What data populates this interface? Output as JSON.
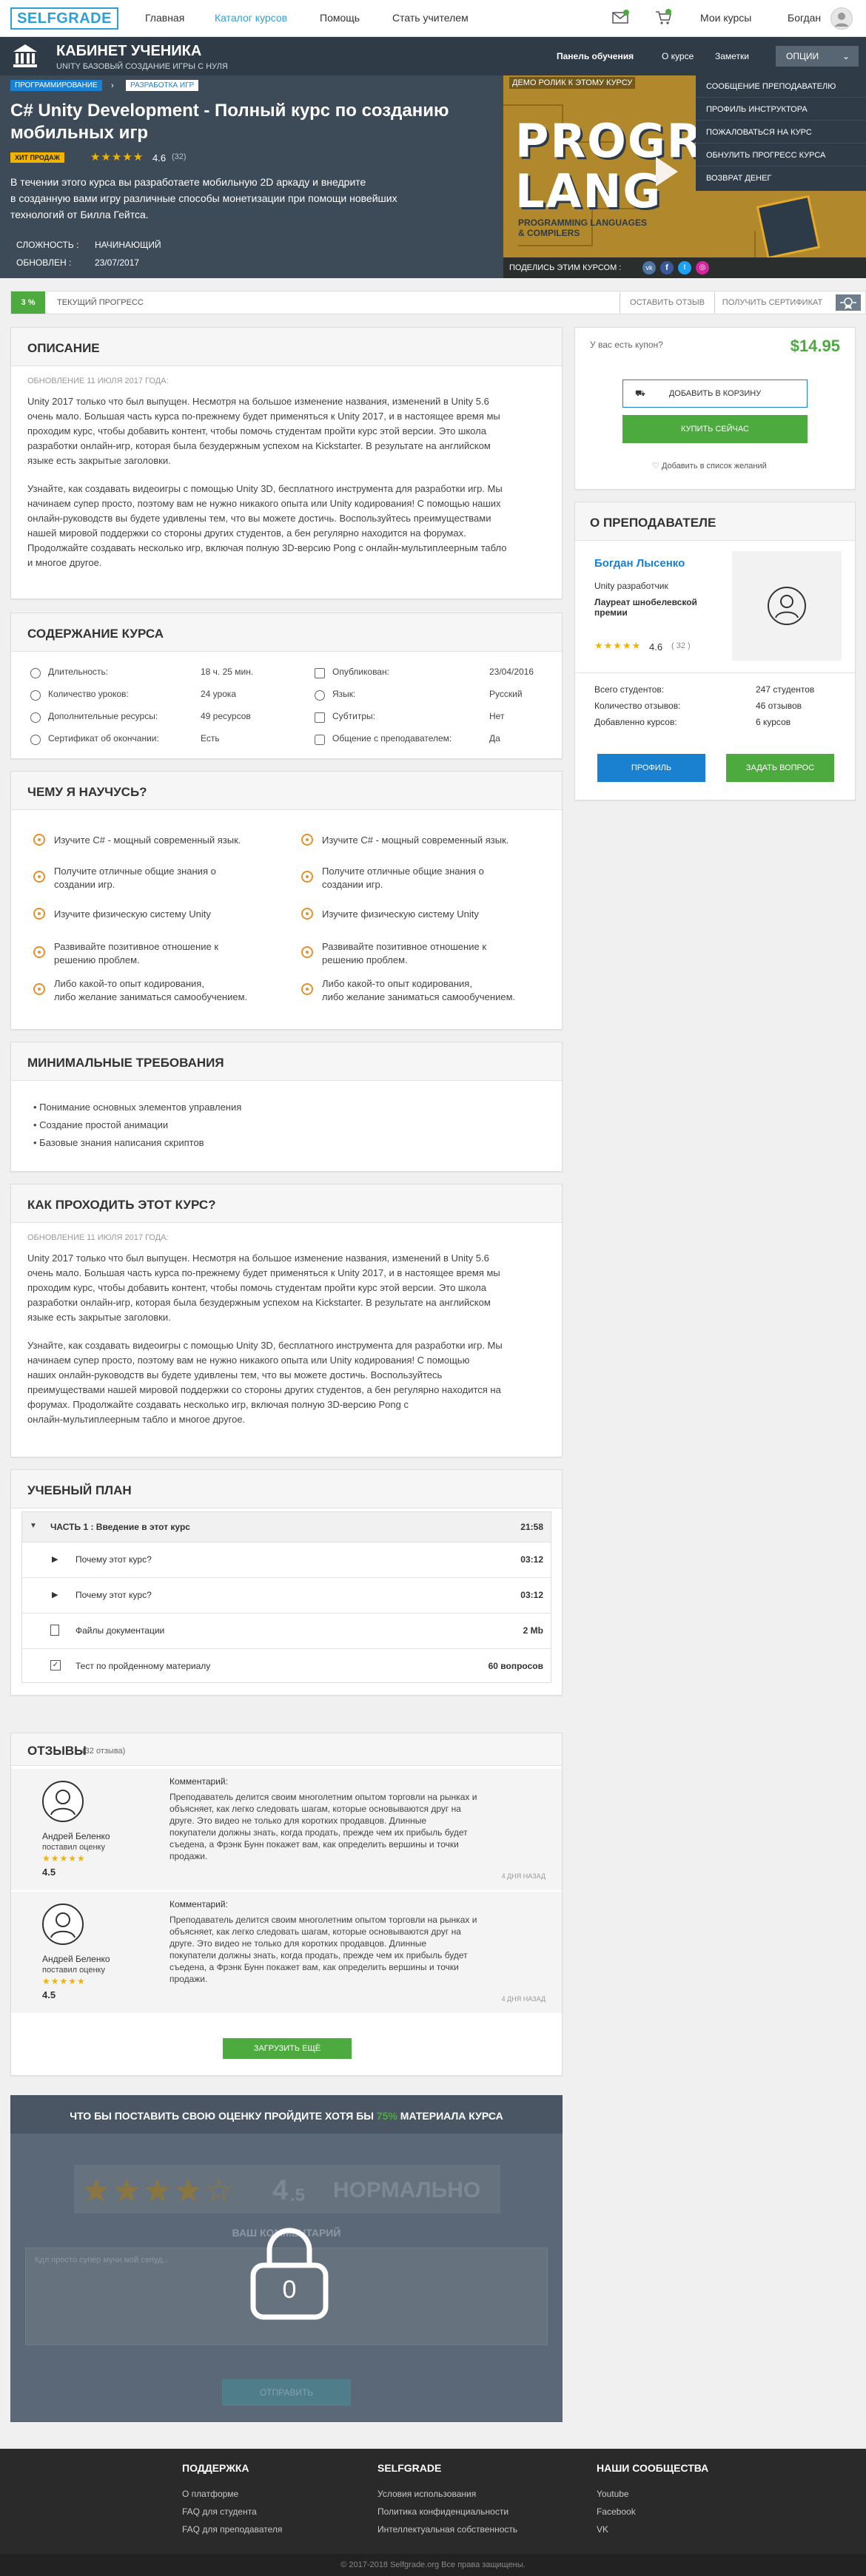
{
  "nav": {
    "logo": "SELFGRADE",
    "links": [
      "Главная",
      "Каталог курсов",
      "Помощь",
      "Стать учителем"
    ],
    "my_courses": "Мои курсы",
    "user": "Богдан",
    "icons": [
      "mail-icon",
      "cart-icon",
      "avatar-icon"
    ]
  },
  "header": {
    "title": "КАБИНЕТ УЧЕНИКА",
    "subtitle": "UNITY БАЗОВЫЙ СОЗДАНИЕ ИГРЫ С НУЛЯ",
    "tabs": [
      "Панель обучения",
      "О курсе",
      "Заметки"
    ],
    "options": "ОПЦИИ"
  },
  "course": {
    "breadcrumb": [
      "ПРОГРАММИРОВАНИЕ",
      "РАЗРАБОТКА ИГР"
    ],
    "title_line1": "C# Unity Development - Полный курс по созданию",
    "title_line2": "мобильных игр",
    "badge": "ХИТ ПРОДАЖ",
    "rating": "4.6",
    "rating_count": "(32)",
    "description_line1": "В течении этого курса вы разработаете мобильную 2D аркаду и внедрите",
    "description_line2": "в созданную вами игру различные способы монетизации при помощи новейших",
    "description_line3": "технологий от Билла Гейтса.",
    "complexity_label": "СЛОЖНОСТЬ :",
    "complexity_value": "НАЧИНАЮЩИЙ",
    "updated_label": "ОБНОВЛЕН :",
    "updated_value": "23/07/2017"
  },
  "video": {
    "demo_label": "ДЕМО РОЛИК К ЭТОМУ КУРСУ",
    "big_text_1": "PROGRA",
    "big_text_2": "LANG",
    "sub_text": "PROGRAMMING LANGUAGES",
    "sub_text2": "& COMPILERS",
    "share_label": "ПОДЕЛИСЬ ЭТИМ КУРСОМ :",
    "menu": [
      "СООБЩЕНИЕ ПРЕПОДАВАТЕЛЮ",
      "ПРОФИЛЬ ИНСТРУКТОРА",
      "ПОЖАЛОВАТЬСЯ НА КУРС",
      "ОБНУЛИТЬ ПРОГРЕСС КУРСА",
      "ВОЗВРАТ ДЕНЕГ"
    ]
  },
  "progress": {
    "percent": "3 %",
    "value": 0.03,
    "label": "ТЕКУЩИЙ ПРОГРЕСС",
    "btn_review": "ОСТАВИТЬ ОТЗЫВ",
    "btn_certificate": "ПОЛУЧИТЬ СЕРТИФИКАТ"
  },
  "description": {
    "title": "ОПИСАНИЕ",
    "updated": "ОБНОВЛЕНИЕ 11 ИЮЛЯ 2017 ГОДА:",
    "p1": [
      "Unity 2017 только что был выпущен. Несмотря на большое изменение названия, изменений в Unity 5.6",
      "очень мало. Большая часть курса по-прежнему будет применяться к Unity 2017, и в настоящее время мы",
      "проходим курс, чтобы добавить контент, чтобы помочь студентам пройти курс этой версии. Это школа",
      "разработки онлайн-игр, которая была безудержным успехом на Kickstarter. В результате на английском",
      "языке есть закрытые заголовки."
    ],
    "p2": [
      "Узнайте, как создавать видеоигры с помощью Unity 3D, бесплатного инструмента для разработки игр. Мы",
      "начинаем супер просто, поэтому вам не нужно никакого опыта или Unity кодирования! С помощью наших",
      "онлайн-руководств вы будете удивлены тем, что вы можете достичь. Воспользуйтесь преимуществами",
      "нашей мировой поддержки со стороны других студентов, а бен регулярно находится на форумах.",
      "Продолжайте создавать несколько игр, включая полную 3D-версию Pong с онлайн-мультиплеерным табло",
      "и многое другое."
    ]
  },
  "content": {
    "title": "СОДЕРЖАНИЕ КУРСА",
    "left": [
      {
        "icon": "clock-icon",
        "label": "Длительность:",
        "value": "18 ч. 25 мин."
      },
      {
        "icon": "play-icon",
        "label": "Количество уроков:",
        "value": "24 урока"
      },
      {
        "icon": "download-icon",
        "label": "Дополнительные ресурсы:",
        "value": "49 ресурсов"
      },
      {
        "icon": "certificate-icon",
        "label": "Сертификат об окончании:",
        "value": "Есть"
      }
    ],
    "right": [
      {
        "icon": "calendar-icon",
        "label": "Опубликован:",
        "value": "23/04/2016"
      },
      {
        "icon": "globe-icon",
        "label": "Язык:",
        "value": "Русский"
      },
      {
        "icon": "subtitles-icon",
        "label": "Субтитры:",
        "value": "Нет"
      },
      {
        "icon": "chat-icon",
        "label": "Общение с преподавателем:",
        "value": "Да"
      }
    ]
  },
  "learn": {
    "title": "ЧЕМУ Я НАУЧУСЬ?",
    "left": [
      [
        "Изучите C# - мощный современный язык."
      ],
      [
        "Получите отличные общие знания о",
        "создании игр."
      ],
      [
        "Изучите физическую систему Unity"
      ],
      [
        "Развивайте позитивное отношение к",
        "решению проблем."
      ],
      [
        "Либо какой-то опыт кодирования,",
        "либо желание заниматься самообучением."
      ]
    ],
    "right": [
      [
        "Изучите C# - мощный современный язык."
      ],
      [
        "Получите отличные общие знания о",
        "создании игр."
      ],
      [
        "Изучите физическую систему Unity"
      ],
      [
        "Развивайте позитивное отношение к",
        "решению проблем."
      ],
      [
        "Либо какой-то опыт кодирования,",
        "либо желание заниматься самообучением."
      ]
    ]
  },
  "requirements": {
    "title": "МИНИМАЛЬНЫЕ ТРЕБОВАНИЯ",
    "items": [
      "Понимание основных элементов управления",
      "Создание простой анимации",
      "Базовые знания написания скриптов"
    ]
  },
  "howto": {
    "title": "КАК ПРОХОДИТЬ ЭТОТ КУРС?",
    "updated": "ОБНОВЛЕНИЕ 11 ИЮЛЯ 2017 ГОДА:",
    "p1": [
      "Unity 2017 только что был выпущен. Несмотря на большое изменение названия, изменений в Unity 5.6",
      "очень мало. Большая часть курса по-прежнему будет применяться к Unity 2017, и в настоящее время мы",
      "проходим курс, чтобы добавить контент, чтобы помочь студентам пройти курс этой версии. Это школа",
      "разработки онлайн-игр, которая была безудержным успехом на Kickstarter. В результате на английском",
      "языке есть закрытые заголовки."
    ],
    "p2": [
      "Узнайте, как создавать видеоигры с помощью Unity 3D, бесплатного инструмента для разработки игр. Мы",
      "начинаем супер просто, поэтому вам не нужно никакого опыта или Unity кодирования! С помощью",
      "наших онлайн-руководств вы будете удивлены тем, что вы можете достичь. Воспользуйтесь",
      "преимуществами нашей мировой поддержки со стороны других студентов, а бен регулярно находится на",
      "форумах. Продолжайте создавать несколько игр, включая полную 3D-версию Pong с",
      "онлайн-мультиплеерным табло и многое другое."
    ]
  },
  "plan": {
    "title": "УЧЕБНЫЙ ПЛАН",
    "section": "ЧАСТЬ 1 : Введение в этот курс",
    "section_time": "21:58",
    "rows": [
      {
        "icon": "play-icon",
        "label": "Почему этот курс?",
        "value": "03:12"
      },
      {
        "icon": "play-icon",
        "label": "Почему этот курс?",
        "value": "03:12"
      },
      {
        "icon": "document-icon",
        "label": "Файлы документации",
        "value": "2 Mb"
      },
      {
        "icon": "test-icon",
        "label": "Тест по пройденному материалу",
        "value": "60 вопросов"
      }
    ]
  },
  "reviews": {
    "title": "ОТЗЫВЫ",
    "count": "(32 отзыва)",
    "items": [
      {
        "name": "Андрей Беленко",
        "action": "поставил оценку",
        "score": "4.5",
        "comment_label": "Комментарий:",
        "text": [
          "Преподаватель делится своим многолетним опытом торговли на рынках и",
          "объясняет, как легко следовать шагам, которые основываются друг на",
          "друге. Это видео не только для коротких продавцов. Длинные",
          "покупатели должны знать, когда продать, прежде чем их прибыль будет",
          "съедена, а Фрэнк Бунн покажет вам, как определить вершины и точки",
          "продажи."
        ],
        "date": "4 ДНЯ НАЗАД"
      },
      {
        "name": "Андрей Беленко",
        "action": "поставил оценку",
        "score": "4.5",
        "comment_label": "Комментарий:",
        "text": [
          "Преподаватель делится своим многолетним опытом торговли на рынках и",
          "объясняет, как легко следовать шагам, которые основываются друг на",
          "друге. Это видео не только для коротких продавцов. Длинные",
          "покупатели должны знать, когда продать, прежде чем их прибыль будет",
          "съедена, а Фрэнк Бунн покажет вам, как определить вершины и точки",
          "продажи."
        ],
        "date": "4 ДНЯ НАЗАД"
      }
    ],
    "load_more": "ЗАГРУЗИТЬ ЕЩЁ"
  },
  "rate": {
    "title_pre": "ЧТО БЫ ПОСТАВИТЬ СВОЮ ОЦЕНКУ ПРОЙДИТЕ ХОТЯ БЫ",
    "title_pct": "75%",
    "title_post": "МАТЕРИАЛА КУРСА",
    "score": "4",
    "score_suffix": ".5",
    "verdict": "НОРМАЛЬНО",
    "comment_label": "ВАШ КОММЕНТАРИЙ",
    "placeholder": "Кдл просто супер мучи мой сепуд...",
    "lock_number": "0",
    "submit": "ОТПРАВИТЬ"
  },
  "sidebar": {
    "coupon": "У вас есть купон?",
    "price": "$14.95",
    "add_to_cart": "ДОБАВИТЬ В КОРЗИНУ",
    "buy_now": "КУПИТЬ СЕЙЧАС",
    "wishlist": "Добавить в список желаний",
    "teacher_title": "О ПРЕПОДАВАТЕЛЕ",
    "teacher_name": "Богдан Лысенко",
    "teacher_role": "Unity разработчик",
    "teacher_award_1": "Лауреат шнобелевской",
    "teacher_award_2": "премии",
    "teacher_rating": "4.6",
    "teacher_rating_count": "( 32 )",
    "stats": [
      {
        "label": "Всего студентов:",
        "value": "247 студентов"
      },
      {
        "label": "Количество отзывов:",
        "value": "46 отзывов"
      },
      {
        "label": "Добавленно курсов:",
        "value": "6 курсов"
      }
    ],
    "profile": "ПРОФИЛЬ",
    "ask": "ЗАДАТЬ ВОПРОС"
  },
  "footer": {
    "col1_title": "ПОДДЕРЖКА",
    "col1": [
      "О платформе",
      "FAQ для студента",
      "FAQ для преподавателя"
    ],
    "col2_title": "SELFGRADE",
    "col2": [
      "Условия использования",
      "Политика конфиденциальности",
      "Интеллектуальная собственность"
    ],
    "col3_title": "НАШИ СООБЩЕСТВА",
    "col3": [
      "Youtube",
      "Facebook",
      "VK"
    ],
    "copyright": "© 2017-2018 Selfgrade.org Все права защищены."
  },
  "colors": {
    "accent": "#2f9fd8",
    "green": "#4caa3e",
    "blue": "#1a81d0",
    "star": "#f0b400",
    "orange": "#e8902e"
  }
}
